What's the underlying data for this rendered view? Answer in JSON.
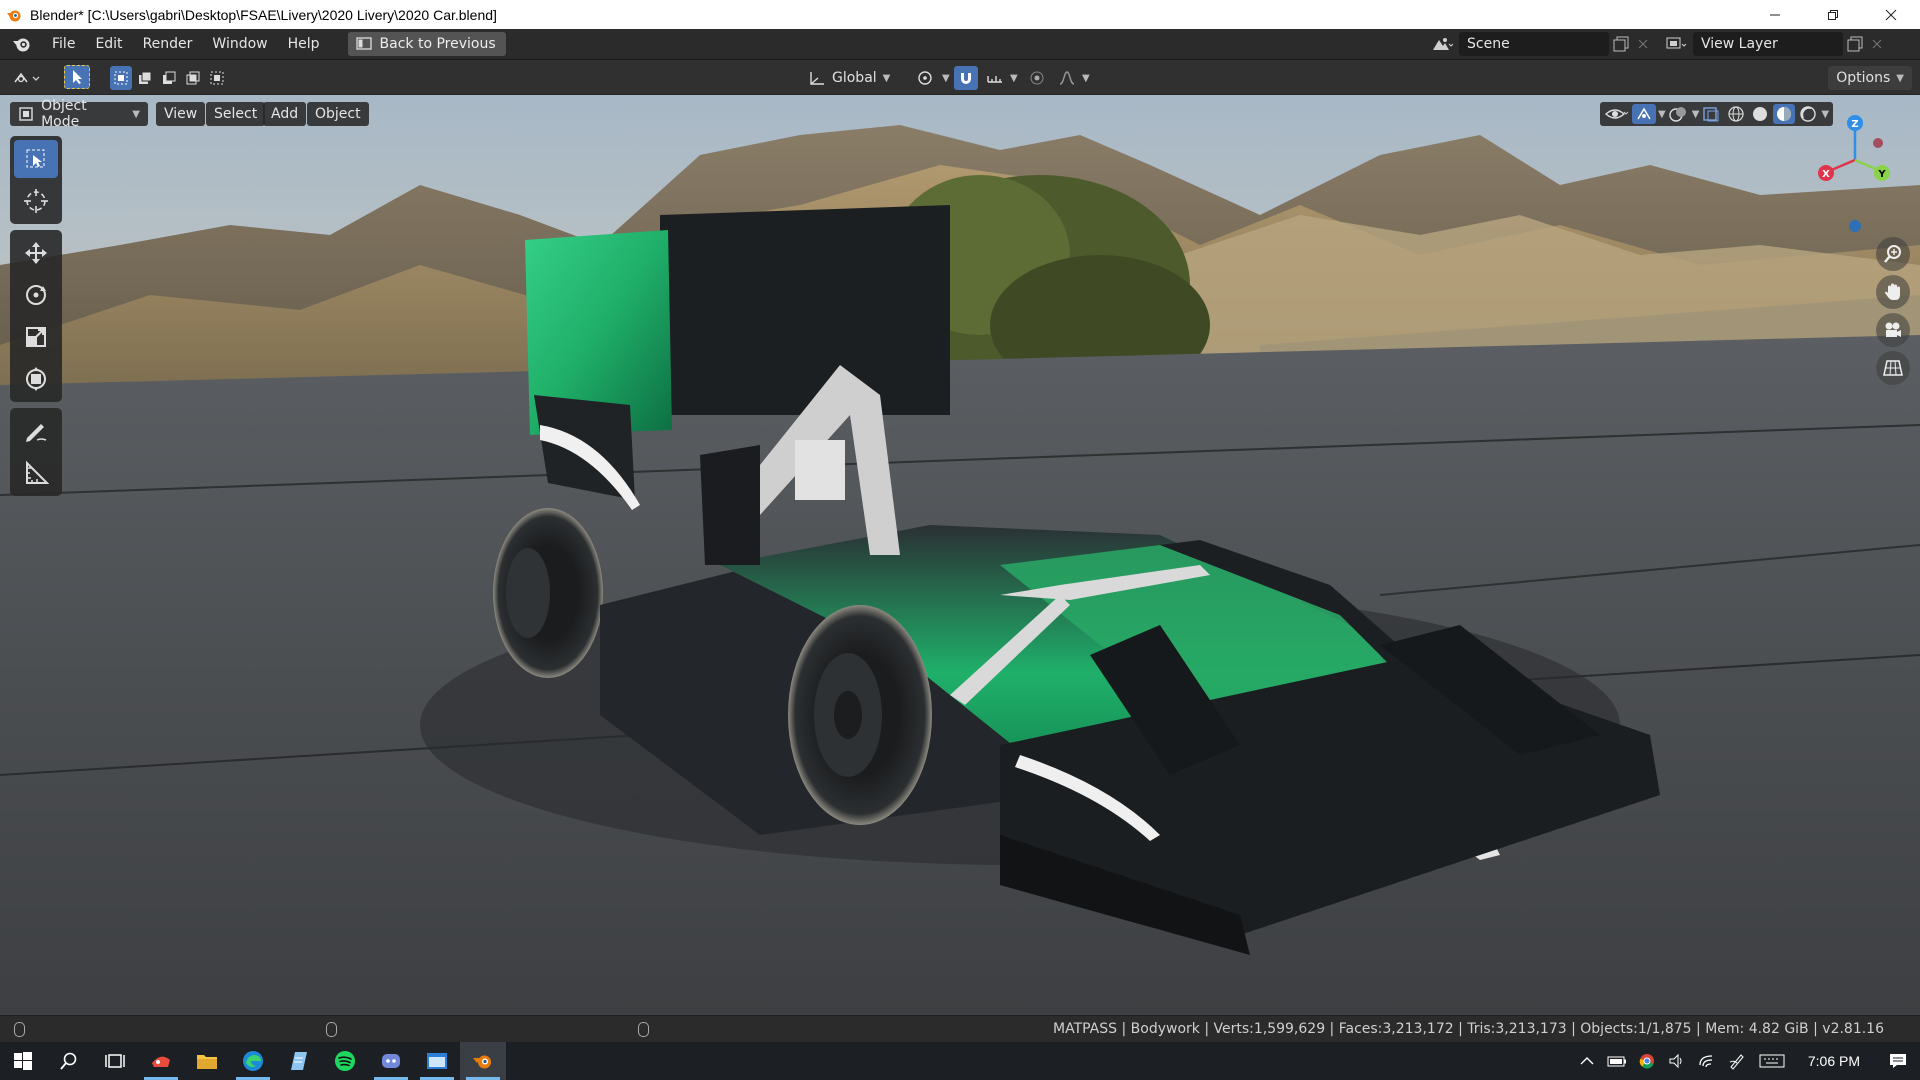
{
  "window": {
    "title": "Blender* [C:\\Users\\gabri\\Desktop\\FSAE\\Livery\\2020 Livery\\2020 Car.blend]",
    "controls": [
      "minimize",
      "restore",
      "close"
    ]
  },
  "menubar": {
    "items": [
      "File",
      "Edit",
      "Render",
      "Window",
      "Help"
    ],
    "back_button": "Back to Previous",
    "scene_label": "Scene",
    "view_layer_label": "View Layer"
  },
  "toolheader": {
    "transform_orientation": "Global",
    "options_label": "Options"
  },
  "viewport": {
    "mode": "Object Mode",
    "menus": [
      "View",
      "Select",
      "Add",
      "Object"
    ],
    "gizmo_axes": {
      "x": "X",
      "y": "Y",
      "z": "Z"
    },
    "colors": {
      "accent": "#4772b3",
      "x_axis": "#e0344a",
      "y_axis": "#8bd346",
      "z_axis": "#2e8ee8",
      "car_green": "#1fb06a"
    }
  },
  "statusbar": {
    "text": "MATPASS | Bodywork | Verts:1,599,629 | Faces:3,213,172 | Tris:3,213,173 | Objects:1/1,875 | Mem: 4.82 GiB | v2.81.16"
  },
  "taskbar": {
    "time": "7:06 PM",
    "apps": [
      "start-icon",
      "search-icon",
      "task-view-icon",
      "app-icon",
      "file-explorer-icon",
      "edge-icon",
      "notepad-icon",
      "spotify-icon",
      "discord-icon",
      "window-app-icon",
      "blender-icon"
    ]
  }
}
